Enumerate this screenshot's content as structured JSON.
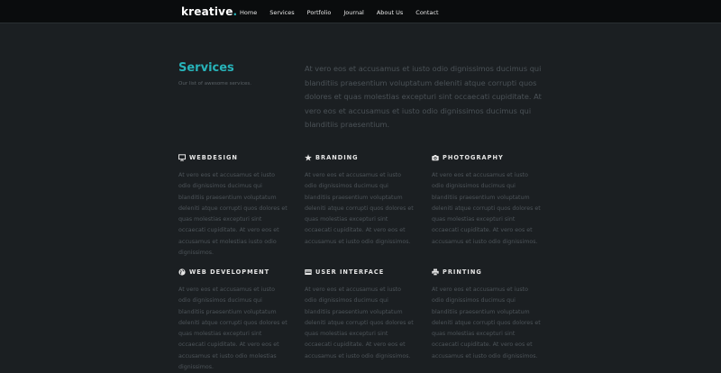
{
  "brand": {
    "name": "kreative",
    "dot": "."
  },
  "nav": {
    "items": [
      "Home",
      "Services",
      "Portfolio",
      "Journal",
      "About Us",
      "Contact"
    ]
  },
  "services": {
    "title": "Services",
    "subtitle": "Our list of awesome services.",
    "intro": "At vero eos et accusamus et iusto odio dignissimos ducimus qui blanditiis praesentium voluptatum deleniti atque corrupti quos dolores et quas molestias excepturi sint occaecati cupiditate. At vero eos et accusamus et iusto odio dignissimos ducimus qui blanditiis praesentium."
  },
  "features": [
    {
      "title": "WEBDESIGN",
      "icon": "monitor-icon",
      "body": "At vero eos et accusamus et iusto odio dignissimos ducimus qui blanditiis praesentium voluptatum deleniti atque corrupti quos dolores et quas molestias excepturi sint occaecati cupiditate. At vero eos et accusamus et molestias iusto odio dignissimos."
    },
    {
      "title": "BRANDING",
      "icon": "star-icon",
      "body": "At vero eos et accusamus et iusto odio dignissimos ducimus qui blanditiis praesentium voluptatum deleniti atque corrupti quos dolores et quas molestias excepturi sint occaecati cupiditate. At vero eos et accusamus et iusto odio dignissimos."
    },
    {
      "title": "PHOTOGRAPHY",
      "icon": "camera-icon",
      "body": "At vero eos et accusamus et iusto odio dignissimos ducimus qui blanditiis praesentium voluptatum deleniti atque corrupti quos dolores et quas molestias excepturi sint occaecati cupiditate. At vero eos et accusamus et iusto odio dignissimos."
    },
    {
      "title": "WEB DEVELOPMENT",
      "icon": "globe-icon",
      "body": "At vero eos et accusamus et iusto odio dignissimos ducimus qui blanditiis praesentium voluptatum deleniti atque corrupti quos dolores et quas molestias excepturi sint occaecati cupiditate. At vero eos et accusamus et iusto odio molestias dignissimos."
    },
    {
      "title": "USER INTERFACE",
      "icon": "interface-icon",
      "body": "At vero eos et accusamus et iusto odio dignissimos ducimus qui blanditiis praesentium voluptatum deleniti atque corrupti quos dolores et quas molestias excepturi sint occaecati cupiditate. At vero eos et accusamus et iusto odio dignissimos."
    },
    {
      "title": "PRINTING",
      "icon": "printer-icon",
      "body": "At vero eos et accusamus et iusto odio dignissimos ducimus qui blanditiis praesentium voluptatum deleniti atque corrupti quos dolores et quas molestias excepturi sint occaecati cupiditate. At vero eos et accusamus et iusto odio dignissimos."
    }
  ],
  "colors": {
    "accent": "#27b3b9",
    "background": "#1b1f22",
    "topbar": "#0a0c0d"
  }
}
